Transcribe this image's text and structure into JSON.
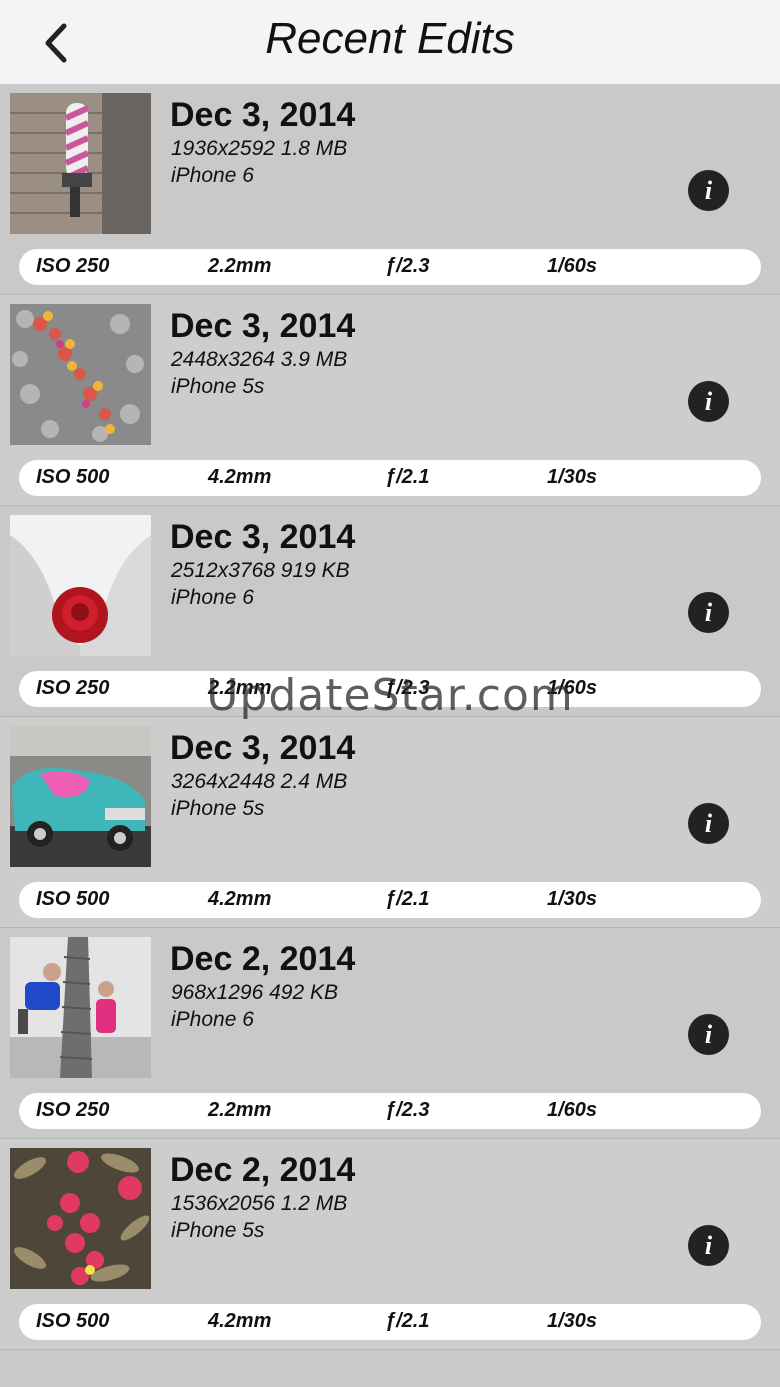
{
  "header": {
    "title": "Recent Edits",
    "back_icon": "chevron-left-icon"
  },
  "items": [
    {
      "date": "Dec 3, 2014",
      "meta": "1936x2592 1.8 MB",
      "model": "iPhone 6",
      "iso": "ISO 250",
      "focal": "2.2mm",
      "fstop": "ƒ/2.3",
      "shutter": "1/60s",
      "info": "i"
    },
    {
      "date": "Dec 3, 2014",
      "meta": "2448x3264 3.9 MB",
      "model": "iPhone 5s",
      "iso": "ISO 500",
      "focal": "4.2mm",
      "fstop": "ƒ/2.1",
      "shutter": "1/30s",
      "info": "i"
    },
    {
      "date": "Dec 3, 2014",
      "meta": "2512x3768 919 KB",
      "model": "iPhone 6",
      "iso": "ISO 250",
      "focal": "2.2mm",
      "fstop": "ƒ/2.3",
      "shutter": "1/60s",
      "info": "i"
    },
    {
      "date": "Dec 3, 2014",
      "meta": "3264x2448 2.4 MB",
      "model": "iPhone 5s",
      "iso": "ISO 500",
      "focal": "4.2mm",
      "fstop": "ƒ/2.1",
      "shutter": "1/30s",
      "info": "i"
    },
    {
      "date": "Dec 2, 2014",
      "meta": "968x1296 492 KB",
      "model": "iPhone 6",
      "iso": "ISO 250",
      "focal": "2.2mm",
      "fstop": "ƒ/2.3",
      "shutter": "1/60s",
      "info": "i"
    },
    {
      "date": "Dec 2, 2014",
      "meta": "1536x2056 1.2 MB",
      "model": "iPhone 5s",
      "iso": "ISO 500",
      "focal": "4.2mm",
      "fstop": "ƒ/2.1",
      "shutter": "1/30s",
      "info": "i"
    }
  ],
  "watermark": "UpdateStar.com"
}
